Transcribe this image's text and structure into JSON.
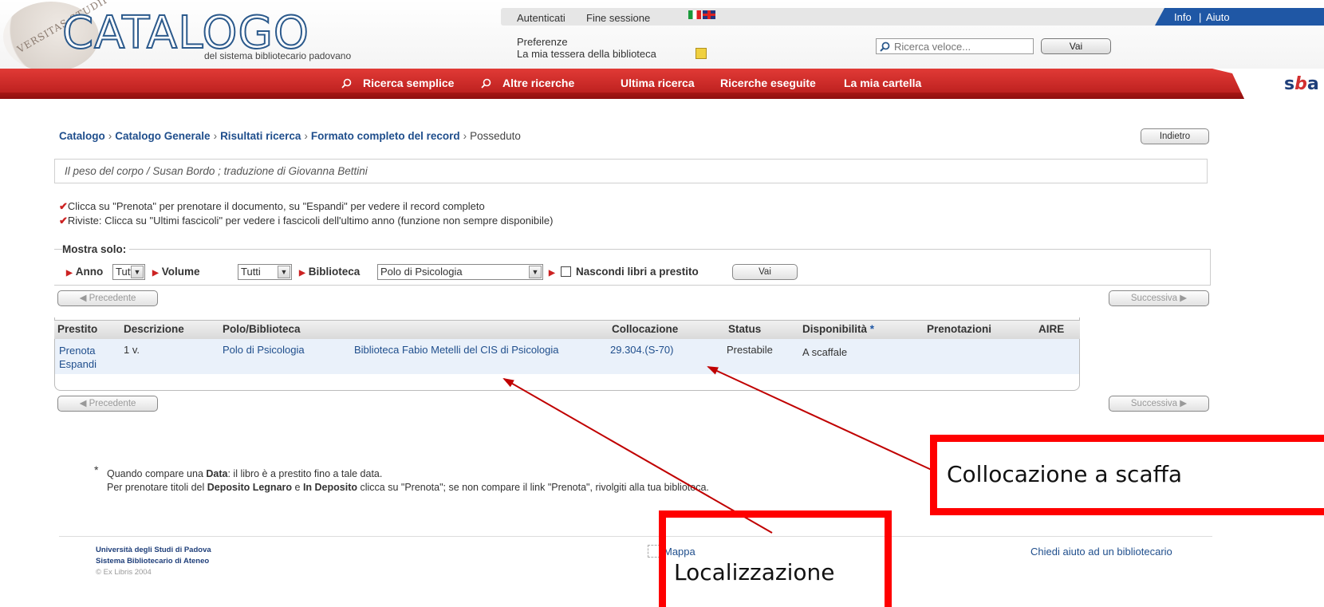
{
  "header": {
    "seal_text": "VERSITAS STUDII",
    "logo_title": "CATALOGO",
    "logo_subtitle": "del sistema bibliotecario padovano",
    "top_links": {
      "login": "Autenticati",
      "logout": "Fine sessione"
    },
    "info_links": {
      "info": "Info",
      "separator": "|",
      "help": "Aiuto"
    },
    "preferences": "Preferenze",
    "library_card": "La mia tessera della biblioteca",
    "quick_search": {
      "placeholder": "Ricerca veloce...",
      "button": "Vai"
    }
  },
  "nav": {
    "items": [
      "Ricerca semplice",
      "Altre ricerche",
      "Ultima ricerca",
      "Ricerche eseguite",
      "La mia cartella"
    ],
    "logo": {
      "left": "s",
      "mid": "b",
      "right": "a"
    }
  },
  "breadcrumb": {
    "items": [
      "Catalogo",
      "Catalogo Generale",
      "Risultati ricerca",
      "Formato completo del record"
    ],
    "separator": "›",
    "current": "Posseduto",
    "back_button": "Indietro"
  },
  "record_title": "Il peso del corpo / Susan Bordo ; traduzione di Giovanna Bettini",
  "hints": {
    "check": "✔",
    "items": [
      "Clicca su \"Prenota\" per prenotare il documento, su \"Espandi\" per vedere il record completo",
      "Riviste: Clicca su \"Ultimi fascicoli\" per vedere i fascicoli dell'ultimo anno (funzione non sempre disponibile)"
    ]
  },
  "filters": {
    "legend": "Mostra solo:",
    "anno": {
      "label": "Anno",
      "value": "Tutti"
    },
    "volume": {
      "label": "Volume",
      "value": "Tutti"
    },
    "biblioteca": {
      "label": "Biblioteca",
      "value": "Polo di Psicologia"
    },
    "hide_loaned": {
      "label": "Nascondi libri a prestito",
      "checked": false
    },
    "submit": "Vai"
  },
  "pager": {
    "prev": "◀ Precedente",
    "next": "Successiva ▶"
  },
  "table": {
    "columns": [
      "Prestito",
      "Descrizione",
      "Polo/Biblioteca",
      "",
      "Collocazione",
      "Status",
      "Disponibilità",
      "Prenotazioni",
      "AIRE"
    ],
    "star": "*",
    "rows": [
      {
        "prestito": [
          "Prenota",
          "Espandi"
        ],
        "descrizione": "1 v.",
        "polo": "Polo di Psicologia",
        "biblioteca": "Biblioteca Fabio Metelli del CIS di Psicologia",
        "collocazione": "29.304.(S-70)",
        "status": "Prestabile",
        "disponibilita": "A scaffale",
        "prenotazioni": "",
        "aire": ""
      }
    ]
  },
  "footnote": {
    "star": "*",
    "line1": {
      "a": "Quando compare una ",
      "b": "Data",
      "c": ": il libro è a prestito fino a tale data."
    },
    "line2": {
      "a": "Per prenotare titoli del ",
      "b": "Deposito Legnaro",
      "c": " e ",
      "d": "In Deposito",
      "e": " clicca su \"Prenota\"; se non compare il link \"Prenota\", rivolgiti alla tua biblioteca."
    }
  },
  "footer": {
    "university": "Università degli Studi di Padova",
    "system": "Sistema Bibliotecario di Ateneo",
    "copyright": "© Ex Libris 2004",
    "map": "Mappa",
    "ask": "Chiedi aiuto ad un bibliotecario"
  },
  "annotations": {
    "shelf_mark": "Collocazione a scaffa",
    "location": "Localizzazione"
  },
  "colors": {
    "nav_red": "#c8241f",
    "link_blue": "#1f4e8c",
    "callout_red": "#ff0000"
  }
}
